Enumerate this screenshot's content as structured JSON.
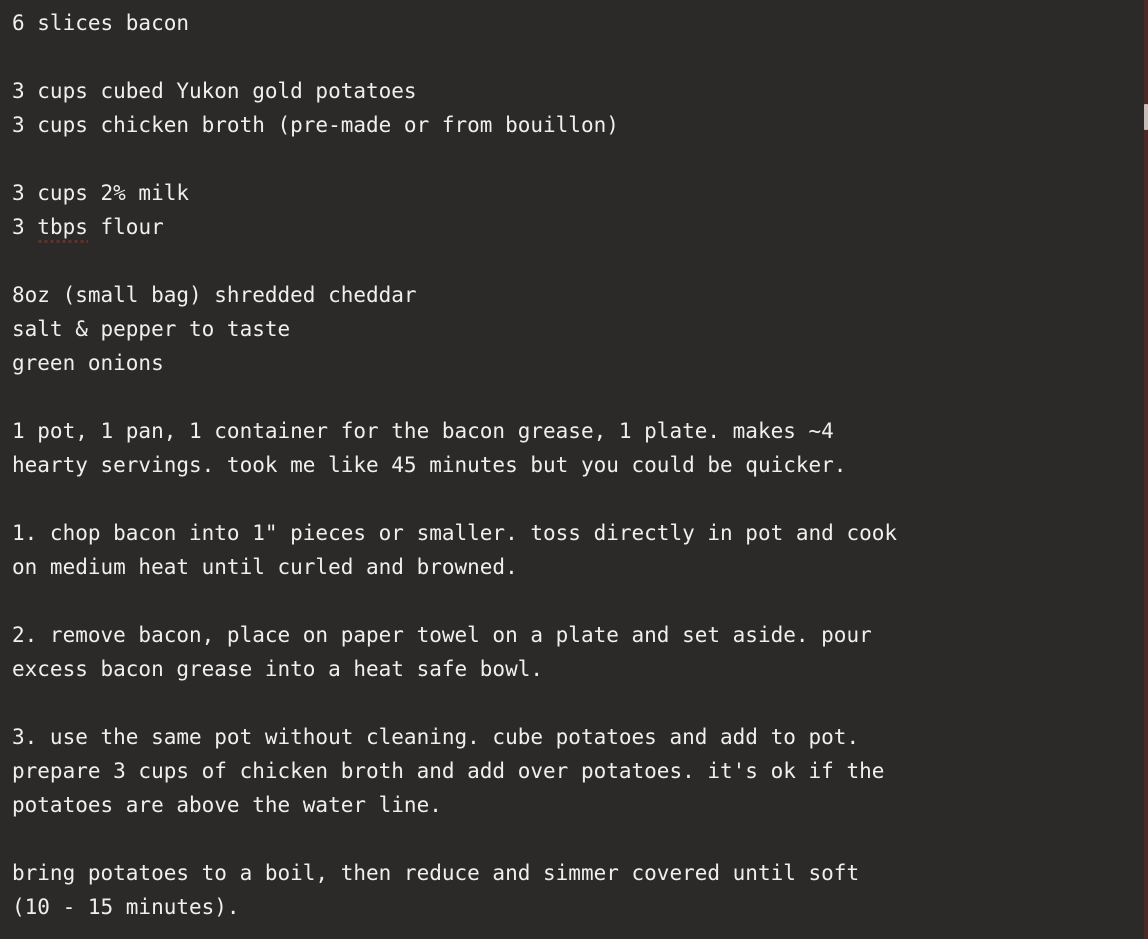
{
  "document": {
    "title": "potato bacon soup recipe",
    "background_color": "#2b2a29",
    "text_color": "#f0efed",
    "spellcheck_underline_color": "#e03c31",
    "lines": [
      {
        "id": "l1",
        "text": "6 slices bacon"
      },
      {
        "id": "l2",
        "text": ""
      },
      {
        "id": "l3",
        "text": "3 cups cubed Yukon gold potatoes"
      },
      {
        "id": "l4",
        "text": "3 cups chicken broth (pre-made or from bouillon)"
      },
      {
        "id": "l5",
        "text": ""
      },
      {
        "id": "l6",
        "text": "3 cups 2% milk"
      },
      {
        "id": "l7",
        "text": "3 tbps flour",
        "misspelled_word": "tbps"
      },
      {
        "id": "l8",
        "text": ""
      },
      {
        "id": "l9",
        "text": "8oz (small bag) shredded cheddar"
      },
      {
        "id": "l10",
        "text": "salt & pepper to taste"
      },
      {
        "id": "l11",
        "text": "green onions"
      },
      {
        "id": "l12",
        "text": ""
      },
      {
        "id": "l13",
        "text": "1 pot, 1 pan, 1 container for the bacon grease, 1 plate. makes ~4"
      },
      {
        "id": "l14",
        "text": "hearty servings. took me like 45 minutes but you could be quicker."
      },
      {
        "id": "l15",
        "text": ""
      },
      {
        "id": "l16",
        "text": "1. chop bacon into 1\" pieces or smaller. toss directly in pot and cook"
      },
      {
        "id": "l17",
        "text": "on medium heat until curled and browned."
      },
      {
        "id": "l18",
        "text": ""
      },
      {
        "id": "l19",
        "text": "2. remove bacon, place on paper towel on a plate and set aside. pour"
      },
      {
        "id": "l20",
        "text": "excess bacon grease into a heat safe bowl."
      },
      {
        "id": "l21",
        "text": ""
      },
      {
        "id": "l22",
        "text": "3. use the same pot without cleaning. cube potatoes and add to pot."
      },
      {
        "id": "l23",
        "text": "prepare 3 cups of chicken broth and add over potatoes. it's ok if the"
      },
      {
        "id": "l24",
        "text": "potatoes are above the water line."
      },
      {
        "id": "l25",
        "text": ""
      },
      {
        "id": "l26",
        "text": "bring potatoes to a boil, then reduce and simmer covered until soft"
      },
      {
        "id": "l27",
        "text": "(10 - 15 minutes)."
      }
    ]
  },
  "scrollbar": {
    "track_color": "#4a2a22",
    "thumb_color": "#c9bdb8",
    "orientation": "vertical"
  }
}
